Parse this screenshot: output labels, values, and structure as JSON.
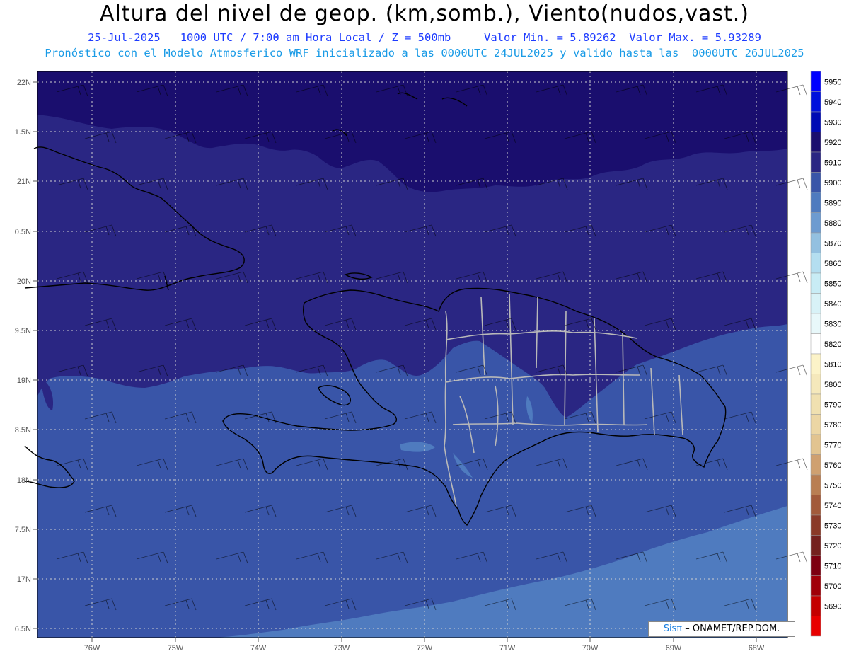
{
  "header": {
    "title": "Altura del nivel de geop. (km,somb.), Viento(nudos,vast.)",
    "line1": "25-Jul-2025   1000 UTC / 7:00 am Hora Local / Z = 500mb     Valor Min. = 5.89262  Valor Max. = 5.93289",
    "line2": "Pronóstico con el Modelo Atmosferico WRF inicializado a las 0000UTC_24JUL2025 y valido hasta las  0000UTC_26JUL2025"
  },
  "axes": {
    "lat_labels": [
      "22N",
      "1.5N",
      "21N",
      "0.5N",
      "20N",
      "9.5N",
      "19N",
      "8.5N",
      "18N",
      "7.5N",
      "17N",
      "6.5N"
    ],
    "lon_labels": [
      "76W",
      "75W",
      "74W",
      "73W",
      "72W",
      "71W",
      "70W",
      "69W",
      "68W"
    ]
  },
  "colorbar": {
    "levels": [
      5950,
      5940,
      5930,
      5920,
      5910,
      5900,
      5890,
      5880,
      5870,
      5860,
      5850,
      5840,
      5830,
      5820,
      5810,
      5800,
      5790,
      5780,
      5770,
      5760,
      5750,
      5740,
      5730,
      5720,
      5710,
      5700,
      5690
    ],
    "colors": [
      "#0000ff",
      "#0010dc",
      "#000ab4",
      "#1a0e6e",
      "#2a2683",
      "#3955a8",
      "#4f7bbf",
      "#6d9bd0",
      "#93c0e0",
      "#b4def0",
      "#c8ecf5",
      "#d8f2f7",
      "#e8f8fa",
      "#ffffff",
      "#fcf3c8",
      "#f5e8bb",
      "#f0e0b0",
      "#ecd6a4",
      "#e2c490",
      "#cfa070",
      "#b97e52",
      "#a25a3a",
      "#8a3a28",
      "#74211e",
      "#7d0010",
      "#a00008",
      "#c40000",
      "#e80000"
    ]
  },
  "fields": {
    "zone_5920": "#1a0e6e",
    "zone_5910": "#2a2683",
    "zone_5900": "#3955a8",
    "zone_5890": "#4f7bbf"
  },
  "footer": {
    "credit_sis": "Sisπ",
    "credit_org": " –  ONAMET/REP.DOM."
  }
}
